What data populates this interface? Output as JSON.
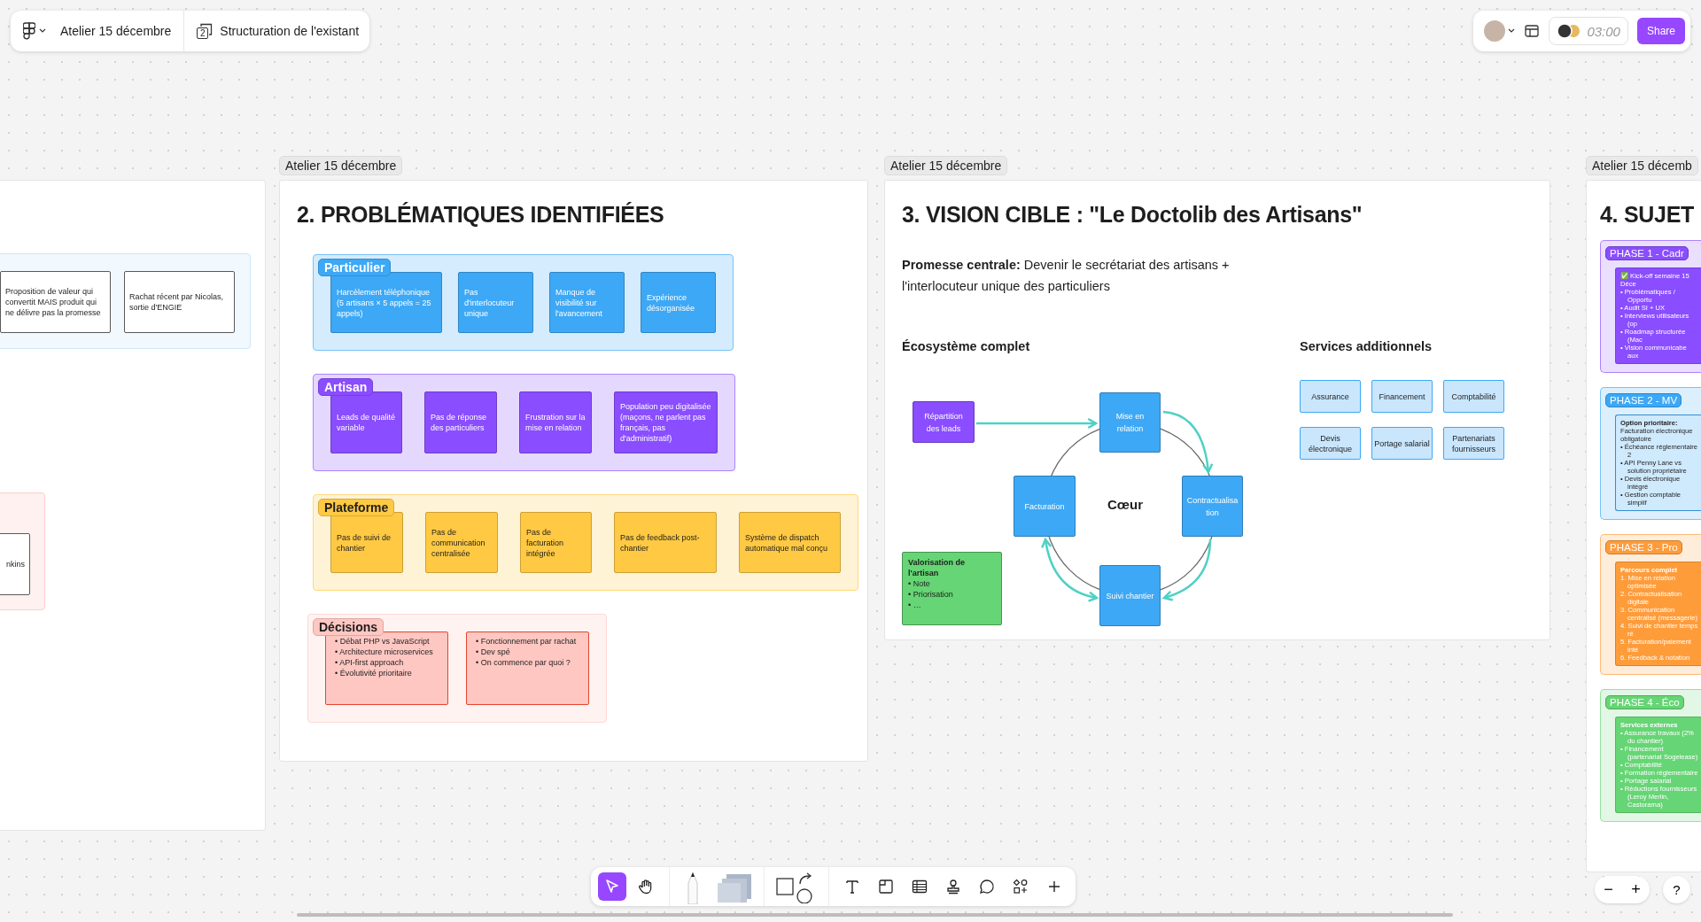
{
  "top_bar": {
    "file_name": "Atelier 15 décembre",
    "page_number": "2",
    "page_name": "Structuration de l'existant",
    "timer": "03:00",
    "share": "Share"
  },
  "frames": [
    {
      "kind": "partial",
      "groups": [
        {
          "color": "#cfe6fb",
          "cards": [
            "Proposition de valeur qui convertit MAIS produit qui ne délivre pas la promesse",
            "Rachat récent par Nicolas, sortie d'ENGIE"
          ]
        },
        {
          "color": "#fbd0cc",
          "cards": [
            "nkins"
          ]
        }
      ]
    },
    {
      "kind": "problems",
      "label": "Atelier 15 décembre",
      "title": "2. PROBLÉMATIQUES IDENTIFIÉES",
      "groups": [
        {
          "name": "Particulier",
          "color": "#3da8f5",
          "cards": [
            {
              "text": "Harcèlement téléphonique (5 artisans × 5 appels = 25 appels)"
            },
            {
              "text": "Pas d'interlocuteur unique"
            },
            {
              "text": "Manque de visibilité sur l'avancement"
            },
            {
              "text": "Expérience désorganisée"
            }
          ]
        },
        {
          "name": "Artisan",
          "color": "#8a4dff",
          "cards": [
            {
              "text": "Leads de qualité variable"
            },
            {
              "text": "Pas de réponse des particuliers"
            },
            {
              "text": "Frustration sur la mise en relation"
            },
            {
              "text": "Population peu digitalisée (maçons, ne parlent pas français, pas d'administratif)"
            }
          ]
        },
        {
          "name": "Plateforme",
          "color": "#ffc943",
          "cards": [
            {
              "text": "Pas de suivi de chantier"
            },
            {
              "text": "Pas de communication centralisée"
            },
            {
              "text": "Pas de facturation intégrée"
            },
            {
              "text": "Pas de feedback post-chantier"
            },
            {
              "text": "Système de dispatch automatique mal conçu"
            }
          ]
        },
        {
          "name": "Décisions",
          "color": "#ffc7c2",
          "cards": [
            {
              "items": [
                "• Débat PHP vs JavaScript",
                "• Architecture microservices",
                "• API-first approach",
                "• Évolutivité prioritaire"
              ]
            },
            {
              "items": [
                "• Fonctionnement par rachat",
                "• Dev spé",
                "• On commence par quoi ?"
              ]
            }
          ]
        }
      ]
    },
    {
      "kind": "vision",
      "label": "Atelier 15 décembre",
      "title": "3. VISION CIBLE : \"Le Doctolib des Artisans\"",
      "promise": "**Promesse centrale:** Devenir le secrétariat des artisans + l'interlocuteur unique des particuliers",
      "ecosystem_heading": "Écosystème complet",
      "services_heading": "Services additionnels",
      "diagram": {
        "center": "Cœur",
        "nodes": [
          {
            "label": "Répartition des leads",
            "color": "#8a4dff"
          },
          {
            "label": "Mise en relation",
            "color": "#3da8f5"
          },
          {
            "label": "Facturation",
            "color": "#3da8f5"
          },
          {
            "label": "Contractualisation",
            "color": "#3da8f5"
          },
          {
            "label": "Suivi chantier",
            "color": "#3da8f5"
          }
        ],
        "note": {
          "title": "Valorisation de l'artisan",
          "items": [
            "• Note",
            "• Priorisation",
            "• …"
          ],
          "color": "#66d575"
        }
      },
      "services": [
        "Assurance",
        "Financement",
        "Comptabilité",
        "Devis électronique",
        "Portage salarial",
        "Partenariats fournisseurs"
      ]
    },
    {
      "kind": "phases",
      "label": "Atelier 15 décemb",
      "title": "4. SUJET",
      "phases": [
        {
          "title": "PHASE 1 - Cadr",
          "color": "#8a4dff",
          "card_light": false,
          "intro": "✅ Kick-off semaine 15 Déce",
          "intro_bold": false,
          "items": [
            "• Problématiques / Opportu",
            "• Audit SI + UX",
            "• Interviews utilisateurs (op",
            "• Roadmap structurée (Mac",
            "• Vision communicabe aux"
          ]
        },
        {
          "title": "PHASE 2 - MV",
          "color": "#3da8f5",
          "card_light": true,
          "intro": "**Option prioritaire:** Facturation électronique obligatoire",
          "intro_bold": false,
          "items": [
            "• Échéance réglementaire 2",
            "• API Penny Lane vs solution propriétaire",
            "• Devis électronique intégré",
            "• Gestion comptable simplif"
          ]
        },
        {
          "title": "PHASE 3 - Pro",
          "color": "#ff9c3a",
          "card_light": false,
          "intro": "Parcours complet",
          "intro_bold": true,
          "items": [
            "1. Mise en relation optimisée",
            "2. Contractualisation digitale",
            "3. Communication centralisé (messagerie)",
            "4. Suivi de chantier temps ré",
            "5. Facturation/paiement inté",
            "6. Feedback & notation"
          ]
        },
        {
          "title": "PHASE 4 - Éco",
          "color": "#66d575",
          "card_light": false,
          "intro": "Services externes",
          "intro_bold": true,
          "items": [
            "• Assurance travaux (2% du chantier)",
            "• Financement (partenariat Sogelease)",
            "• Comptabilité",
            "• Formation réglementaire",
            "• Portage salarial",
            "• Réductions fournisseurs (Leroy Merlin, Castorama)"
          ]
        }
      ]
    }
  ],
  "tools": [
    {
      "kind": "select",
      "selected": true
    },
    {
      "kind": "hand",
      "selected": false
    },
    {
      "kind": "pen",
      "selected": false
    },
    {
      "kind": "sticky",
      "selected": false
    },
    {
      "kind": "shapes",
      "selected": false
    },
    {
      "kind": "text",
      "selected": false
    },
    {
      "kind": "section",
      "selected": false
    },
    {
      "kind": "table",
      "selected": false
    },
    {
      "kind": "stamp",
      "selected": false
    },
    {
      "kind": "comment",
      "selected": false
    },
    {
      "kind": "widgets",
      "selected": false
    },
    {
      "kind": "more",
      "selected": false
    }
  ],
  "zoom_controls": {
    "zoom_out": "−",
    "zoom_in": "+",
    "help": "?"
  }
}
